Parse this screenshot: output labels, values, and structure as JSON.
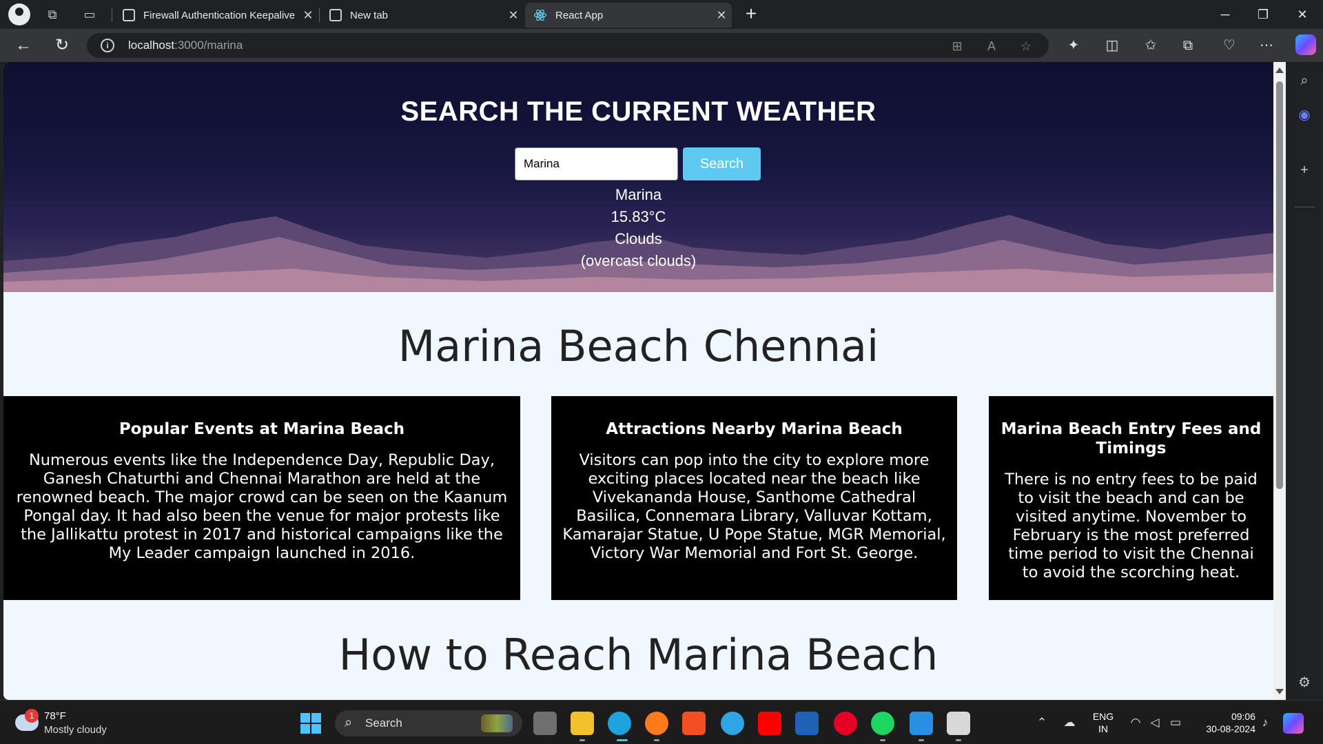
{
  "browser": {
    "tabs": [
      {
        "title": "Firewall Authentication Keepalive",
        "active": false
      },
      {
        "title": "New tab",
        "active": false
      },
      {
        "title": "React App",
        "active": true
      }
    ],
    "url_host": "localhost",
    "url_path": ":3000/marina"
  },
  "hero": {
    "title": "SEARCH THE CURRENT WEATHER",
    "search_value": "Marina",
    "search_button": "Search",
    "city": "Marina",
    "temperature": "15.83°C",
    "condition": "Clouds",
    "description": "(overcast clouds)"
  },
  "main": {
    "heading": "Marina Beach Chennai",
    "cards": [
      {
        "title": "Popular Events at Marina Beach",
        "text": "Numerous events like the Independence Day, Republic Day, Ganesh Chaturthi and Chennai Marathon are held at the renowned beach. The major crowd can be seen on the Kaanum Pongal day. It had also been the venue for major protests like the Jallikattu protest in 2017 and historical campaigns like the My Leader campaign launched in 2016."
      },
      {
        "title": "Attractions Nearby Marina Beach",
        "text": "Visitors can pop into the city to explore more exciting places located near the beach like Vivekananda House, Santhome Cathedral Basilica, Connemara Library, Valluvar Kottam, Kamarajar Statue, U Pope Statue, MGR Memorial, Victory War Memorial and Fort St. George."
      },
      {
        "title": "Marina Beach Entry Fees and Timings",
        "text": "There is no entry fees to be paid to visit the beach and can be visited anytime. November to February is the most preferred time period to visit the Chennai to avoid the scorching heat."
      }
    ],
    "heading2": "How to Reach Marina Beach"
  },
  "taskbar": {
    "weather_badge": "1",
    "weather_temp": "78°F",
    "weather_condition": "Mostly cloudy",
    "search_label": "Search",
    "lang_line1": "ENG",
    "lang_line2": "IN",
    "time": "09:06",
    "date": "30-08-2024"
  },
  "colors": {
    "hero_dark": "#0f0f30",
    "search_button": "#5dc8f0",
    "page_background": "#f0f8ff",
    "card_background": "#000000"
  }
}
